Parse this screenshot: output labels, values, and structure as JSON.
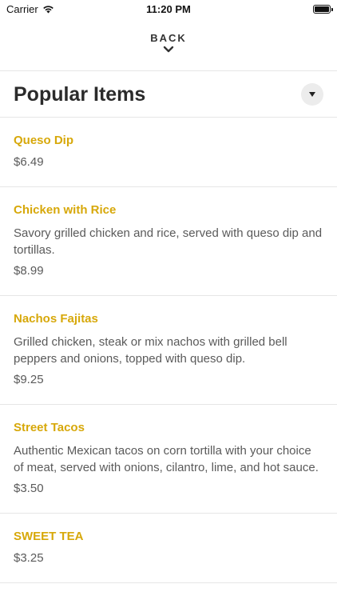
{
  "status_bar": {
    "carrier": "Carrier",
    "time": "11:20 PM"
  },
  "nav": {
    "back_label": "BACK"
  },
  "section": {
    "title": "Popular Items"
  },
  "items": [
    {
      "name": "Queso Dip",
      "description": "",
      "price": "$6.49"
    },
    {
      "name": "Chicken with Rice",
      "description": "Savory grilled chicken and rice, served with queso dip and tortillas.",
      "price": "$8.99"
    },
    {
      "name": "Nachos Fajitas",
      "description": "Grilled chicken, steak or mix nachos with grilled bell peppers and onions, topped with queso dip.",
      "price": "$9.25"
    },
    {
      "name": "Street Tacos",
      "description": "Authentic Mexican tacos on corn tortilla with your choice of meat, served with onions, cilantro, lime, and hot sauce.",
      "price": "$3.50"
    },
    {
      "name": "SWEET TEA",
      "description": "",
      "price": "$3.25"
    }
  ],
  "colors": {
    "accent": "#d7a80a",
    "text": "#5a5a5a",
    "divider": "#e6e6e6"
  },
  "icons": {
    "wifi": "wifi-icon",
    "battery": "battery-icon",
    "back": "chevron-down-icon",
    "dropdown": "triangle-down-icon"
  }
}
